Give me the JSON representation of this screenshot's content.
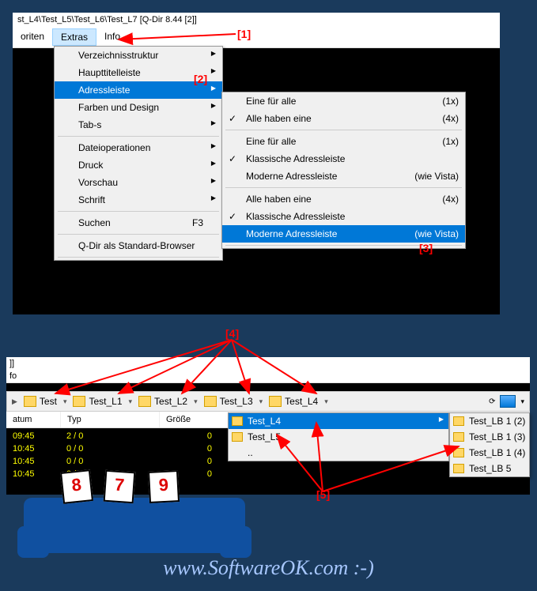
{
  "window": {
    "title": "st_L4\\Test_L5\\Test_L6\\Test_L7  [Q-Dir 8.44 [2]]"
  },
  "menubar": {
    "favorites": "oriten",
    "extras": "Extras",
    "info": "Info"
  },
  "extras_menu": {
    "structure": "Verzeichnisstruktur",
    "titlebar": "Haupttitelleiste",
    "addressbar": "Adressleiste",
    "colors": "Farben und Design",
    "tabs": "Tab-s",
    "fileops": "Dateioperationen",
    "print": "Druck",
    "preview": "Vorschau",
    "font": "Schrift",
    "search": "Suchen",
    "search_key": "F3",
    "default_browser": "Q-Dir als Standard-Browser"
  },
  "addressbar_submenu": {
    "one_for_all_1": "Eine für alle",
    "one_for_all_1_hint": "(1x)",
    "all_have_one_1": "Alle haben eine",
    "all_have_one_1_hint": "(4x)",
    "one_for_all_2": "Eine für alle",
    "one_for_all_2_hint": "(1x)",
    "classic_1": "Klassische Adressleiste",
    "modern_1": "Moderne Adressleiste",
    "modern_1_hint": "(wie Vista)",
    "all_have_one_2": "Alle haben eine",
    "all_have_one_2_hint": "(4x)",
    "classic_2": "Klassische Adressleiste",
    "modern_2": "Moderne Adressleiste",
    "modern_2_hint": "(wie Vista)"
  },
  "bottom": {
    "title_suffix": "]]",
    "menu_info": "fo"
  },
  "breadcrumb": {
    "segs": [
      "Test",
      "Test_L1",
      "Test_L2",
      "Test_L3",
      "Test_L4"
    ]
  },
  "bc_dropdown1": {
    "items": [
      "Test_L4",
      "Test_L5",
      ".."
    ]
  },
  "bc_dropdown2": {
    "items": [
      "Test_LB 1 (2)",
      "Test_LB 1 (3)",
      "Test_LB 1 (4)",
      "Test_LB 5"
    ]
  },
  "table": {
    "headers": {
      "datum": "atum",
      "typ": "Typ",
      "groesse": "Größe"
    },
    "rows": [
      {
        "time": "09:45",
        "typ": "2 / 0",
        "size": "0"
      },
      {
        "time": "10:45",
        "typ": "0 / 0",
        "size": "0"
      },
      {
        "time": "10:45",
        "typ": "0 / 0",
        "size": "0"
      },
      {
        "time": "10:45",
        "typ": "0 / 0",
        "size": "0"
      }
    ]
  },
  "annotations": {
    "a1": "[1]",
    "a2": "[2]",
    "a3": "[3]",
    "a4": "[4]",
    "a5": "[5]"
  },
  "cards": {
    "c1": "8",
    "c2": "7",
    "c3": "9"
  },
  "watermark": "www.SoftwareOK.com :-)"
}
